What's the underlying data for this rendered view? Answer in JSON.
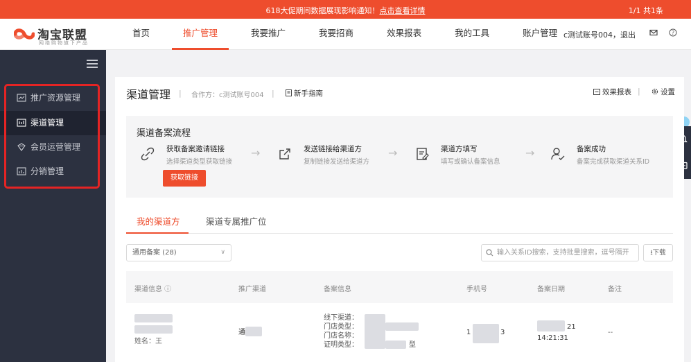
{
  "notice": {
    "message": "618大促期间数据展现影响通知！",
    "link": "点击查看详情",
    "pager": "1/1  共1条"
  },
  "logo": {
    "name": "淘宝联盟",
    "tagline": "网络购物旗下产品"
  },
  "nav": {
    "items": [
      "首页",
      "推广管理",
      "我要推广",
      "我要招商",
      "效果报表",
      "我的工具",
      "账户管理"
    ],
    "active_index": 1,
    "account": "c测试账号004，退出"
  },
  "sidebar": {
    "items": [
      {
        "label": "推广资源管理",
        "icon": "resource-icon",
        "active": false
      },
      {
        "label": "渠道管理",
        "icon": "channel-icon",
        "active": true
      },
      {
        "label": "会员运营管理",
        "icon": "member-icon",
        "active": false
      },
      {
        "label": "分销管理",
        "icon": "distribution-icon",
        "active": false
      }
    ]
  },
  "page": {
    "title": "渠道管理",
    "partner": "合作方：c测试账号004",
    "guide": "新手指南",
    "report": "效果报表",
    "settings": "设置"
  },
  "flow": {
    "title": "渠道备案流程",
    "steps": [
      {
        "title": "获取备案邀请链接",
        "desc": "选择渠道类型获取链接",
        "icon": "link-icon"
      },
      {
        "title": "发送链接给渠道方",
        "desc": "复制链接发送给渠道方",
        "icon": "share-icon"
      },
      {
        "title": "渠道方填写",
        "desc": "填写或确认备案信息",
        "icon": "form-icon"
      },
      {
        "title": "备案成功",
        "desc": "备案完成获取渠道关系ID",
        "icon": "user-check-icon"
      }
    ],
    "button": "获取链接"
  },
  "tabs": [
    "我的渠道方",
    "渠道专属推广位"
  ],
  "filter": {
    "select_value": "通用备案 (28)",
    "search_placeholder": "输入关系ID搜索，支持批量搜索，逗号隔开",
    "download": "下载"
  },
  "table": {
    "headers": [
      "渠道信息 ⓘ",
      "推广渠道",
      "备案信息",
      "手机号",
      "备案日期",
      "备注"
    ],
    "row": {
      "channel_info": "姓名：王",
      "channel": "通",
      "record_lines": [
        "线下渠道：",
        "门店类型：",
        "门店名称：",
        "证明类型："
      ],
      "record_tail": "型",
      "phone_start": "1",
      "phone_end": "3",
      "date_end": "21",
      "time": "14:21:31",
      "note": "--"
    }
  },
  "colors": {
    "accent": "#ee4d2d",
    "sidebar": "#2c3140",
    "highlight_box": "#e52424"
  }
}
